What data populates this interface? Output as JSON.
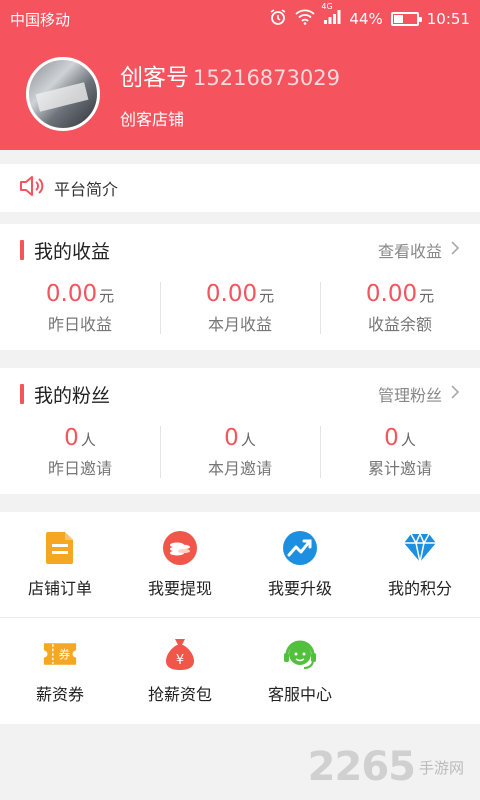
{
  "status_bar": {
    "carrier": "中国移动",
    "network": "4G",
    "battery": "44%",
    "battery_level": 0.44,
    "time": "10:51"
  },
  "profile": {
    "name": "创客号",
    "phone": "15216873029",
    "shop": "创客店铺"
  },
  "notice": {
    "label": "平台简介"
  },
  "earnings": {
    "title": "我的收益",
    "link": "查看收益",
    "items": [
      {
        "value": "0.00",
        "unit": "元",
        "label": "昨日收益"
      },
      {
        "value": "0.00",
        "unit": "元",
        "label": "本月收益"
      },
      {
        "value": "0.00",
        "unit": "元",
        "label": "收益余额"
      }
    ]
  },
  "fans": {
    "title": "我的粉丝",
    "link": "管理粉丝",
    "items": [
      {
        "value": "0",
        "unit": "人",
        "label": "昨日邀请"
      },
      {
        "value": "0",
        "unit": "人",
        "label": "本月邀请"
      },
      {
        "value": "0",
        "unit": "人",
        "label": "累计邀请"
      }
    ]
  },
  "grid": {
    "row1": [
      {
        "label": "店铺订单",
        "icon": "order-icon"
      },
      {
        "label": "我要提现",
        "icon": "coins-icon"
      },
      {
        "label": "我要升级",
        "icon": "upgrade-icon"
      },
      {
        "label": "我的积分",
        "icon": "diamond-icon"
      }
    ],
    "row2": [
      {
        "label": "薪资券",
        "icon": "coupon-icon"
      },
      {
        "label": "抢薪资包",
        "icon": "money-bag-icon"
      },
      {
        "label": "客服中心",
        "icon": "headset-icon"
      }
    ]
  },
  "coupon_glyph": "券",
  "money_bag_glyph": "¥",
  "watermark": {
    "number": "2265",
    "sub": "手游网"
  },
  "colors": {
    "brand": "#f5535e",
    "orange": "#f5a623",
    "blue": "#1d8fe0",
    "green": "#52c03c"
  }
}
